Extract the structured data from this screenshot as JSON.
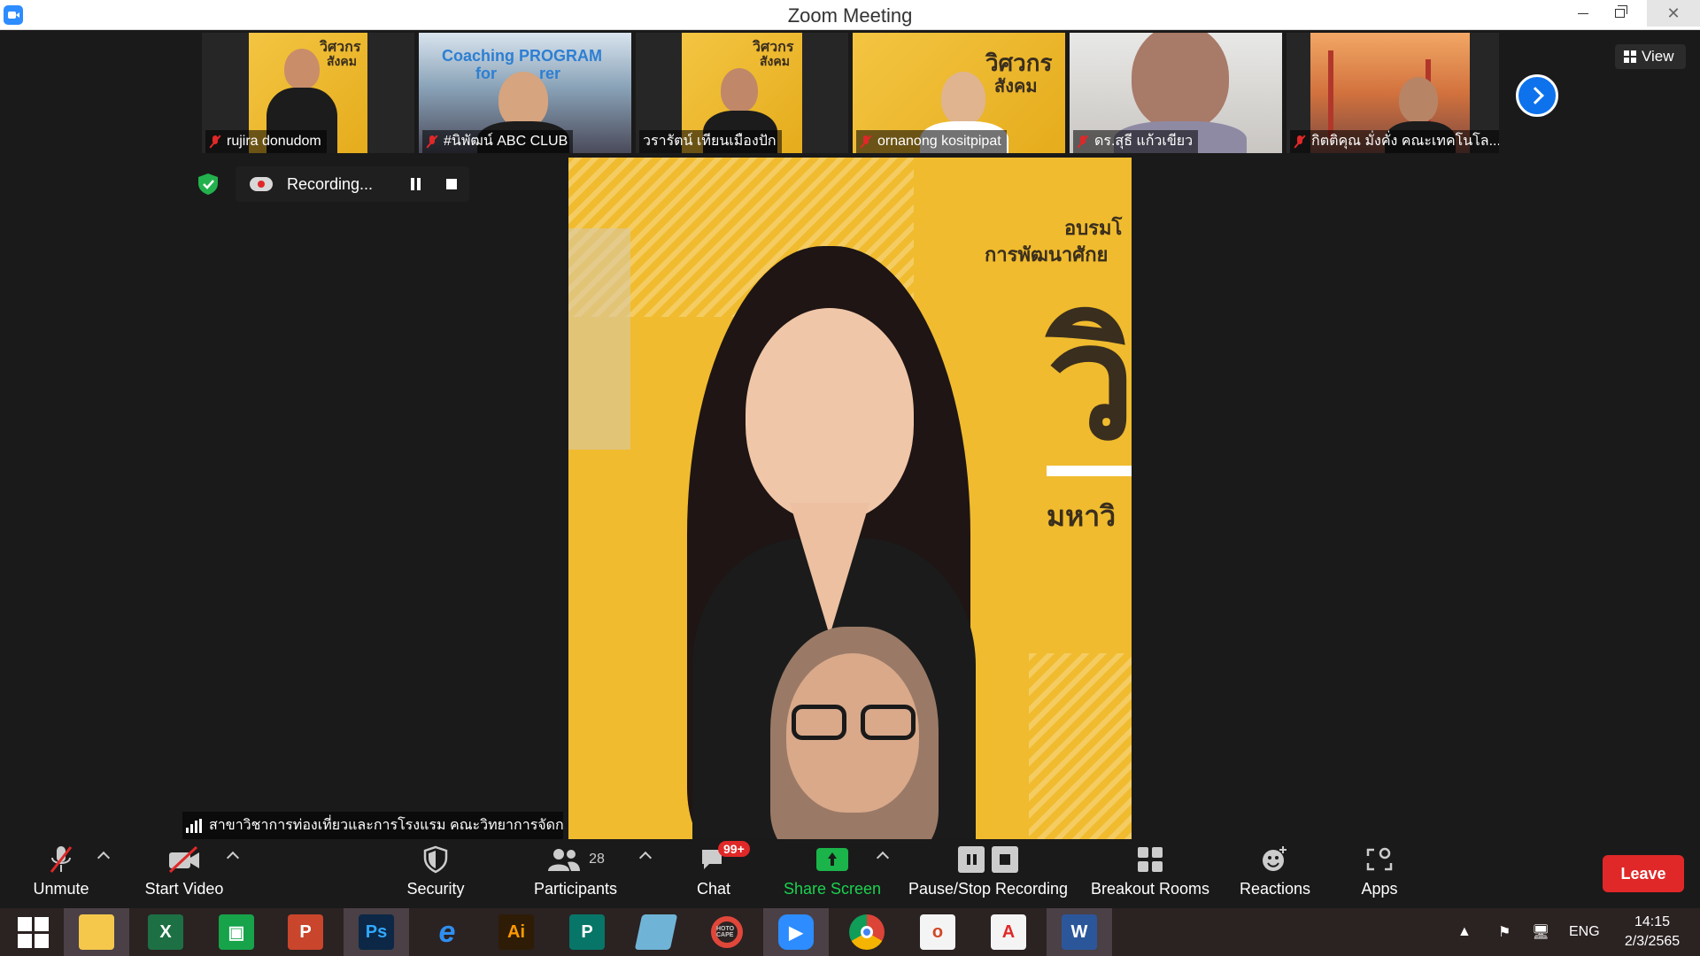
{
  "window": {
    "title": "Zoom Meeting"
  },
  "gallery": {
    "participants": [
      {
        "name": "rujira donudom",
        "muted": true
      },
      {
        "name": "#นิพัฒน์ ABC CLUB",
        "muted": true
      },
      {
        "name": "วรารัตน์ เทียนเมืองปัก",
        "muted": false
      },
      {
        "name": "ornanong kositpipat",
        "muted": true
      },
      {
        "name": "ดร.สุธี แก้วเขียว",
        "muted": true
      },
      {
        "name": "กิตติคุณ มั่งคั่ง คณะเทคโนโล...",
        "muted": true
      }
    ],
    "thumb2_banner": "Coaching PROGRAM",
    "thumb2_banner2": "for",
    "thumb2_banner3": "rer",
    "poster_logo_text": "วิศวกร",
    "poster_logo_text2": "สังคม"
  },
  "view_button": {
    "label": "View"
  },
  "recording": {
    "label": "Recording..."
  },
  "main_video": {
    "poster_line1": "อบรมโ",
    "poster_line2": "การพัฒนาศักย",
    "poster_big": "วิ",
    "poster_bottom": "มหาวิ"
  },
  "caption": {
    "text": "สาขาวิชาการท่องเที่ยวและการโรงแรม คณะวิทยาการจัดการ"
  },
  "toolbar": {
    "unmute": "Unmute",
    "start_video": "Start Video",
    "security": "Security",
    "participants": "Participants",
    "participants_count": "28",
    "chat": "Chat",
    "chat_badge": "99+",
    "share_screen": "Share Screen",
    "pause_stop_recording": "Pause/Stop Recording",
    "breakout_rooms": "Breakout Rooms",
    "reactions": "Reactions",
    "apps": "Apps",
    "leave": "Leave"
  },
  "taskbar": {
    "apps": [
      "file-explorer",
      "excel",
      "publisher-green",
      "powerpoint",
      "photoshop",
      "internet-explorer",
      "illustrator",
      "publisher",
      "notepad",
      "photoscape",
      "zoom",
      "chrome",
      "office",
      "acrobat",
      "word"
    ],
    "ps_label": "Ps",
    "ai_label": "Ai",
    "photoscape_label": "HOTO CAPE",
    "language": "ENG",
    "time": "14:15",
    "date": "2/3/2565"
  },
  "colors": {
    "accent_blue": "#0e72ed",
    "leave_red": "#e02828",
    "share_green": "#1bb44a",
    "poster_yellow": "#f0bb2e"
  }
}
